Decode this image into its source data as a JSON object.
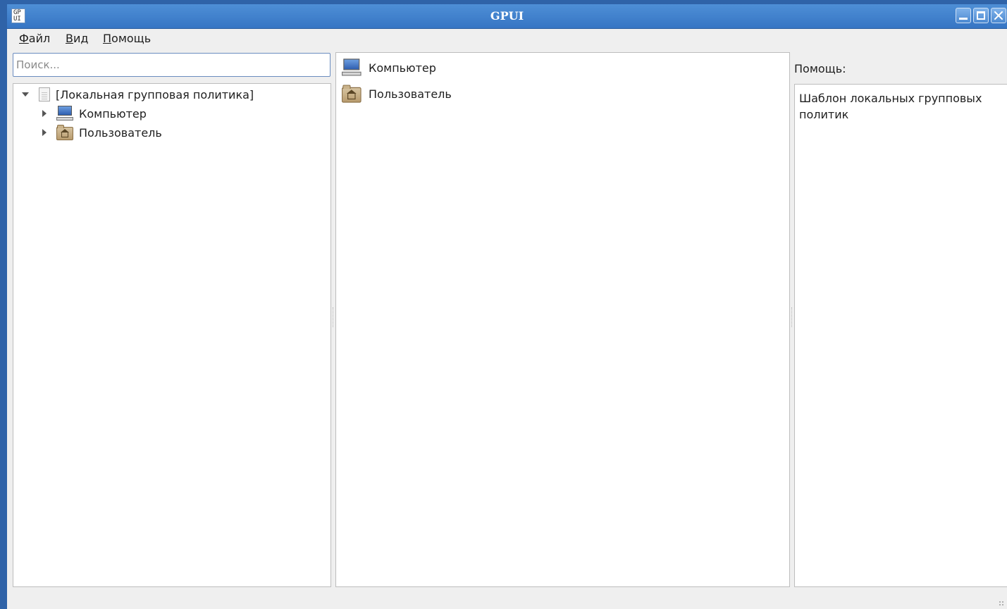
{
  "window": {
    "title": "GPUI",
    "app_icon_text": "GP\nUI"
  },
  "menu": {
    "file": {
      "mnemonic": "Ф",
      "rest": "айл"
    },
    "view": {
      "mnemonic": "В",
      "rest": "ид"
    },
    "help": {
      "mnemonic": "П",
      "rest": "омощь"
    }
  },
  "search": {
    "placeholder": "Поиск...",
    "value": ""
  },
  "tree": {
    "root": {
      "label": "[Локальная групповая политика]",
      "icon": "document-icon",
      "expanded": true
    },
    "children": [
      {
        "label": "Компьютер",
        "icon": "computer-icon",
        "expanded": false
      },
      {
        "label": "Пользователь",
        "icon": "user-folder-icon",
        "expanded": false
      }
    ]
  },
  "content": {
    "items": [
      {
        "label": "Компьютер",
        "icon": "computer-icon"
      },
      {
        "label": "Пользователь",
        "icon": "user-folder-icon"
      }
    ]
  },
  "help": {
    "label": "Помощь:",
    "text": "Шаблон локальных групповых политик"
  },
  "colors": {
    "titlebar": "#3b7bc9",
    "window_bg": "#efefef",
    "panel_bg": "#ffffff",
    "focus_border": "#6b8cbf"
  }
}
